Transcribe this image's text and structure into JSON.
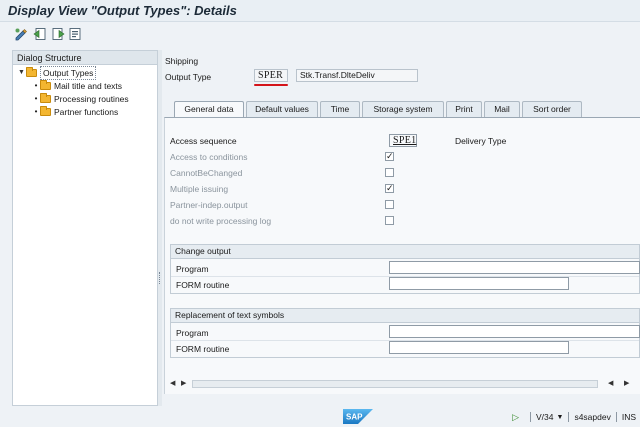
{
  "window": {
    "title": "Display View \"Output Types\": Details"
  },
  "toolbar": {
    "buttons": [
      {
        "name": "edit-toggle-icon"
      },
      {
        "name": "previous-entry-icon"
      },
      {
        "name": "next-entry-icon"
      },
      {
        "name": "other-entry-icon"
      }
    ]
  },
  "tree": {
    "header": "Dialog Structure",
    "items": [
      {
        "label": "Output Types"
      },
      {
        "label": "Mail title and texts"
      },
      {
        "label": "Processing routines"
      },
      {
        "label": "Partner functions"
      }
    ]
  },
  "header": {
    "section": "Shipping",
    "output_type_label": "Output Type",
    "output_type_value": "SPER",
    "output_type_desc": "Stk.Transf.DlteDeliv"
  },
  "tabs": [
    {
      "label": "General data",
      "active": true
    },
    {
      "label": "Default values"
    },
    {
      "label": "Time"
    },
    {
      "label": "Storage system"
    },
    {
      "label": "Print"
    },
    {
      "label": "Mail"
    },
    {
      "label": "Sort order"
    }
  ],
  "general": {
    "access_sequence_label": "Access sequence",
    "access_sequence_value": "SPE1",
    "access_sequence_desc": "Delivery Type",
    "options": [
      {
        "label": "Access to conditions",
        "checked": true
      },
      {
        "label": "CannotBeChanged",
        "checked": false
      },
      {
        "label": "Multiple issuing",
        "checked": true
      },
      {
        "label": "Partner-indep.output",
        "checked": false
      },
      {
        "label": "do not write processing log",
        "checked": false
      }
    ]
  },
  "change_output": {
    "title": "Change output",
    "program_label": "Program",
    "program_value": "",
    "form_label": "FORM routine",
    "form_value": ""
  },
  "replacement": {
    "title": "Replacement of text symbols",
    "program_label": "Program",
    "program_value": "",
    "form_label": "FORM routine",
    "form_value": ""
  },
  "statusbar": {
    "session": "V/34",
    "system": "s4sapdev",
    "mode": "INS",
    "logo_text": "SAP"
  },
  "colors": {
    "highlight_underline": "#d4141a",
    "folder": "#f3b631"
  }
}
